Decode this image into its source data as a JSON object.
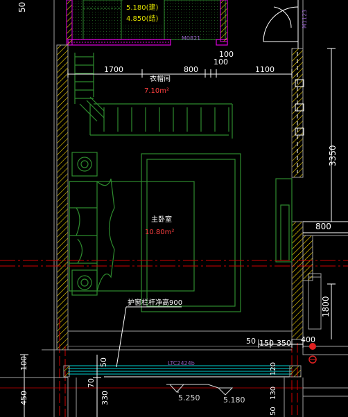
{
  "colors": {
    "background": "#000000",
    "dimension": "#ffffff",
    "wall_hatch": "#ffdc00",
    "wall_outline": "#a0a0a0",
    "furniture": "#2e8b2e",
    "window": "#00d0d0",
    "room_label": "#ffffff",
    "room_area": "#ff4040",
    "axis": "#d00000",
    "magenta": "#e000e0",
    "elevation": "#d8d8d8",
    "door_tag": "#9060c0",
    "symbol": "#e02020",
    "upper_room_text": "#e0e000"
  },
  "rooms": {
    "wardrobe_name": "衣帽间",
    "wardrobe_area": "7.10m²",
    "master_bedroom_name": "主卧室",
    "master_bedroom_area": "10.80m²"
  },
  "upper_room": {
    "elev_1": "5.180(建)",
    "elev_2": "4.850(结)"
  },
  "tags": {
    "door_tag_top": "M0821",
    "door_tag_right": "M1123",
    "window_tag": "LTC2424b",
    "railing_note": "护窗栏杆净高900"
  },
  "dims": {
    "top_1700": "1700",
    "top_800": "800",
    "top_100a": "100",
    "top_100b": "100",
    "top_1100": "1100",
    "right_3350": "3350",
    "right_800": "800",
    "right_1800": "1800",
    "bottom_50": "50",
    "bottom_150": "150",
    "bottom_350": "350",
    "bottom_400": "400",
    "left_50": "50",
    "left_100": "100",
    "left_450": "450",
    "left_70": "70",
    "left_330": "330",
    "bottom_120": "120",
    "bottom_50b": "50",
    "bottom_130": "130",
    "top_left_50": "50"
  },
  "elevations": {
    "level_a": "5.250",
    "level_b": "5.180"
  }
}
